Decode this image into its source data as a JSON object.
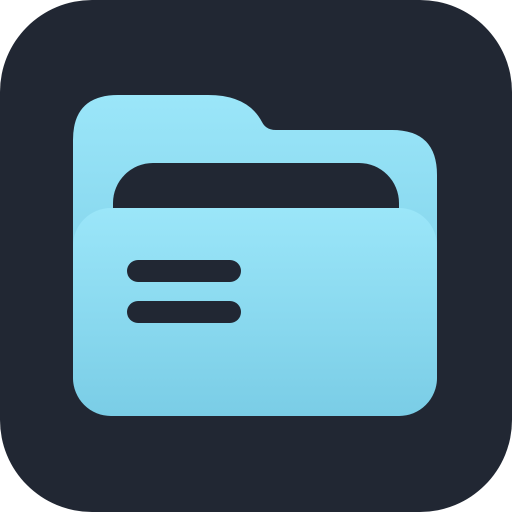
{
  "icon": {
    "name": "file-manager-app-icon",
    "glyph": "folder-icon",
    "colors": {
      "background": "#212733",
      "folder_light": "#9BE6F9",
      "folder_dark": "#7ACDE6",
      "slot": "#212733",
      "lines": "#212733"
    }
  }
}
